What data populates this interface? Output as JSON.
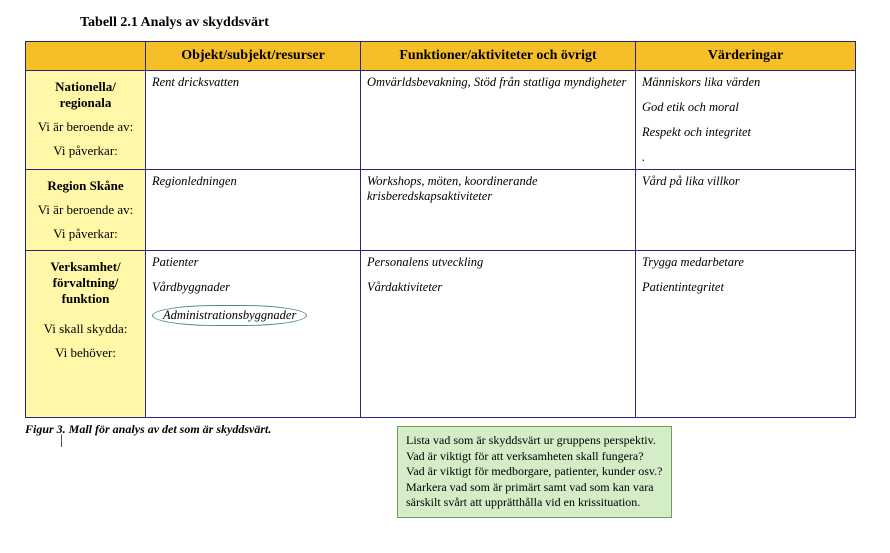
{
  "title": "Tabell 2.1 Analys av skyddsvärt",
  "headers": {
    "col1": "Objekt/subjekt/resurser",
    "col2": "Funktioner/aktiviteter och övrigt",
    "col3": "Värderingar"
  },
  "rows": [
    {
      "head_main": "Nationella/ regionala",
      "head_sub1": "Vi är beroende av:",
      "head_sub2": "Vi påverkar:",
      "c1": "Rent dricksvatten",
      "c2": "Omvärldsbevakning, Stöd från statliga myndigheter",
      "c3_a": "Människors lika värden",
      "c3_b": "God etik och moral",
      "c3_c": "Respekt och integritet",
      "c3_d": "."
    },
    {
      "head_main": "Region Skåne",
      "head_sub1": "Vi är beroende av:",
      "head_sub2": "Vi påverkar:",
      "c1": "Regionledningen",
      "c2": "Workshops, möten, koordinerande krisberedskapsaktiviteter",
      "c3": "Vård på lika villkor"
    },
    {
      "head_main": "Verksamhet/ förvaltning/ funktion",
      "head_sub1": "Vi skall skydda:",
      "head_sub2": "Vi behöver:",
      "c1_a": "Patienter",
      "c1_b": "Vårdbyggnader",
      "c1_c": "Administrationsbyggnader",
      "c2_a": "Personalens utveckling",
      "c2_b": "Vårdaktiviteter",
      "c3_a": "Trygga medarbetare",
      "c3_b": "Patientintegritet"
    }
  ],
  "callout": "Lista vad som är skyddsvärt ur gruppens perspektiv. Vad är viktigt för att verksamheten skall fungera? Vad är viktigt för medborgare, patienter, kunder osv.? Markera vad som är primärt samt vad som kan vara särskilt svårt att upprätthålla vid en krissituation.",
  "caption": "Figur 3. Mall för analys av det som är skyddsvärt.",
  "chart_data": {
    "type": "table",
    "title": "Tabell 2.1 Analys av skyddsvärt",
    "columns": [
      "",
      "Objekt/subjekt/resurser",
      "Funktioner/aktiviteter och övrigt",
      "Värderingar"
    ],
    "rows": [
      [
        "Nationella/ regionala — Vi är beroende av: / Vi påverkar:",
        "Rent dricksvatten",
        "Omvärldsbevakning, Stöd från statliga myndigheter",
        "Människors lika värden; God etik och moral; Respekt och integritet"
      ],
      [
        "Region Skåne — Vi är beroende av: / Vi påverkar:",
        "Regionledningen",
        "Workshops, möten, koordinerande krisberedskapsaktiviteter",
        "Vård på lika villkor"
      ],
      [
        "Verksamhet/ förvaltning/ funktion — Vi skall skydda: / Vi behöver:",
        "Patienter; Vårdbyggnader; Administrationsbyggnader",
        "Personalens utveckling; Vårdaktiviteter",
        "Trygga medarbetare; Patientintegritet"
      ]
    ]
  }
}
